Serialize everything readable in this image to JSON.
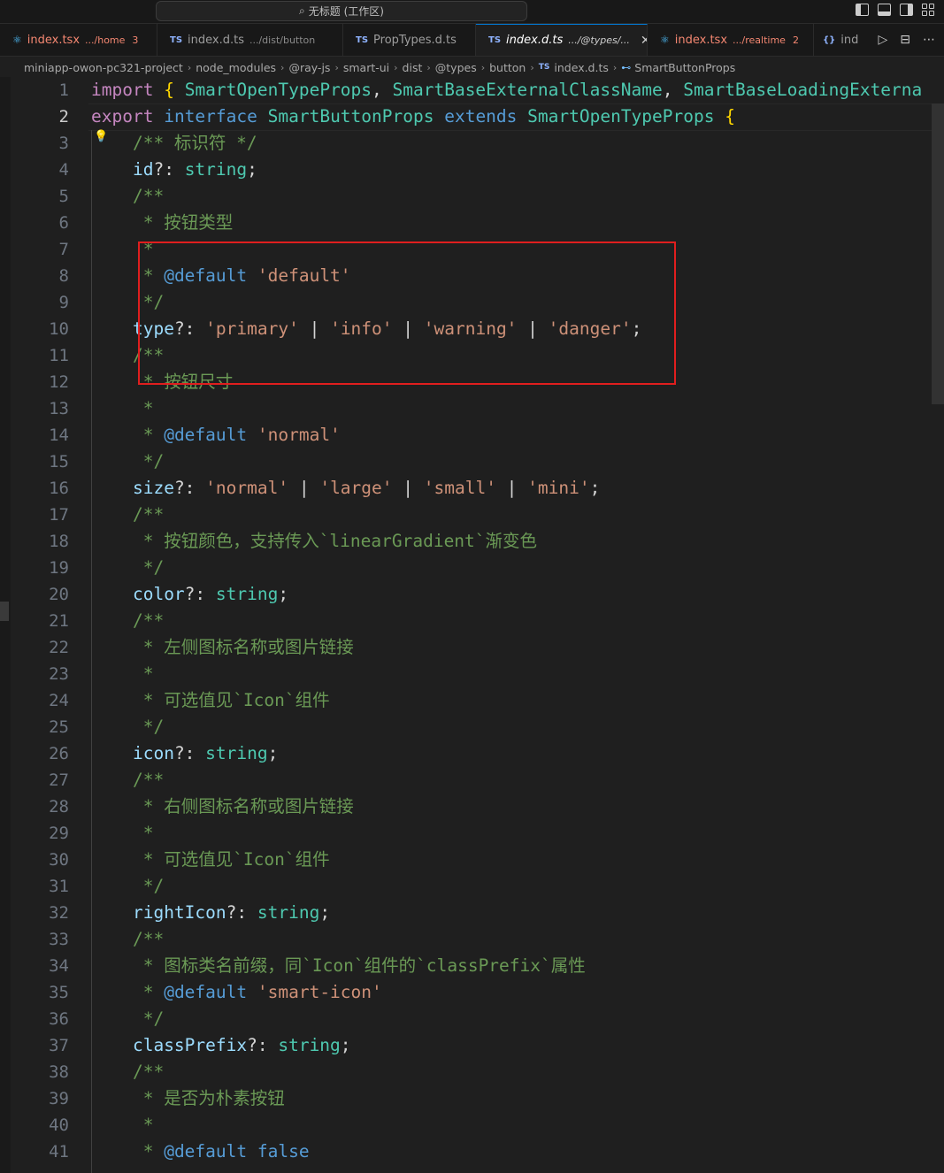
{
  "window": {
    "title": "无标题 (工作区)"
  },
  "tabs": [
    {
      "icon": "react-icon",
      "name": "index.tsx",
      "desc": ".../home",
      "count": "3",
      "error": true,
      "active": false
    },
    {
      "icon": "ts-icon",
      "name": "index.d.ts",
      "desc": ".../dist/button",
      "count": "",
      "error": false,
      "active": false
    },
    {
      "icon": "ts-icon",
      "name": "PropTypes.d.ts",
      "desc": "",
      "count": "",
      "error": false,
      "active": false
    },
    {
      "icon": "ts-icon",
      "name": "index.d.ts",
      "desc": ".../@types/...",
      "count": "",
      "error": false,
      "active": true
    },
    {
      "icon": "react-icon",
      "name": "index.tsx",
      "desc": ".../realtime",
      "count": "2",
      "error": true,
      "active": false
    },
    {
      "icon": "json-icon",
      "name": "inde",
      "desc": "",
      "count": "",
      "error": false,
      "active": false
    }
  ],
  "tab_icons": {
    "ts": "TS",
    "react": "⚛",
    "json": "{}",
    "close": "✕"
  },
  "breadcrumb": [
    "miniapp-owon-pc321-project",
    "node_modules",
    "@ray-js",
    "smart-ui",
    "dist",
    "@types",
    "button",
    "index.d.ts",
    "SmartButtonProps"
  ],
  "editor": {
    "current_line": 2,
    "line_numbers": [
      "1",
      "2",
      "3",
      "4",
      "5",
      "6",
      "7",
      "8",
      "9",
      "10",
      "11",
      "12",
      "13",
      "14",
      "15",
      "16",
      "17",
      "18",
      "19",
      "20",
      "21",
      "22",
      "23",
      "24",
      "25",
      "26",
      "27",
      "28",
      "29",
      "30",
      "31",
      "32",
      "33",
      "34",
      "35",
      "36",
      "37",
      "38",
      "39",
      "40",
      "41"
    ],
    "code": {
      "l1": {
        "import": "import",
        "brace": "{",
        "a": "SmartOpenTypeProps",
        "b": "SmartBaseExternalClassName",
        "c": "SmartBaseLoadingExterna"
      },
      "l2": {
        "export": "export",
        "interface": "interface",
        "name": "SmartButtonProps",
        "extends": "extends",
        "base": "SmartOpenTypeProps",
        "brace": "{"
      },
      "l3": "/** 标识符 */",
      "l4": {
        "prop": "id",
        "type": "string"
      },
      "l5": "/**",
      "l6": " * 按钮类型",
      "l7": " *",
      "l8": {
        "tag": "@default",
        "value": "'default'"
      },
      "l9": " */",
      "l10": {
        "prop": "type",
        "v1": "'primary'",
        "v2": "'info'",
        "v3": "'warning'",
        "v4": "'danger'"
      },
      "l11": "/**",
      "l12": " * 按钮尺寸",
      "l13": " *",
      "l14": {
        "tag": "@default",
        "value": "'normal'"
      },
      "l15": " */",
      "l16": {
        "prop": "size",
        "v1": "'normal'",
        "v2": "'large'",
        "v3": "'small'",
        "v4": "'mini'"
      },
      "l17": "/**",
      "l18": " * 按钮颜色，支持传入`linearGradient`渐变色",
      "l19": " */",
      "l20": {
        "prop": "color",
        "type": "string"
      },
      "l21": "/**",
      "l22": " * 左侧图标名称或图片链接",
      "l23": " *",
      "l24": " * 可选值见`Icon`组件",
      "l25": " */",
      "l26": {
        "prop": "icon",
        "type": "string"
      },
      "l27": "/**",
      "l28": " * 右侧图标名称或图片链接",
      "l29": " *",
      "l30": " * 可选值见`Icon`组件",
      "l31": " */",
      "l32": {
        "prop": "rightIcon",
        "type": "string"
      },
      "l33": "/**",
      "l34": " * 图标类名前缀，同`Icon`组件的`classPrefix`属性",
      "l35": {
        "tag": "@default",
        "value": "'smart-icon'"
      },
      "l36": " */",
      "l37": {
        "prop": "classPrefix",
        "type": "string"
      },
      "l38": "/**",
      "l39": " * 是否为朴素按钮",
      "l40": " *",
      "l41": {
        "tag": "@default",
        "value": "false"
      }
    }
  },
  "colors": {
    "keyword": "#c586c0",
    "type": "#4ec9b0",
    "string": "#ce9178",
    "comment": "#6a9955",
    "annotation_box": "#e01e1e"
  }
}
